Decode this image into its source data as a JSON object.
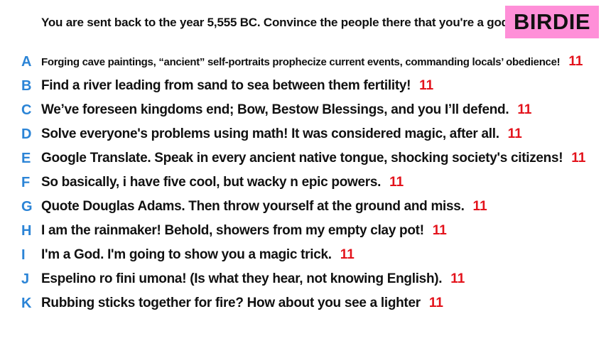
{
  "prompt": "You are sent back to the year 5,555 BC. Convince the people there that you're a god.",
  "badge": "BIRDIE",
  "colors": {
    "letter": "#2b84d6",
    "score": "#e3121b",
    "badge_bg": "#ff8fd8"
  },
  "answers": [
    {
      "letter": "A",
      "text": "Forging cave paintings, “ancient” self-portraits prophecize current events, commanding locals’ obedience!",
      "score": "11"
    },
    {
      "letter": "B",
      "text": "Find a river leading from sand to sea between them fertility!",
      "score": "11"
    },
    {
      "letter": "C",
      "text": "We’ve foreseen kingdoms end; Bow, Bestow Blessings, and you I’ll defend.",
      "score": "11"
    },
    {
      "letter": "D",
      "text": "Solve everyone's problems using math! It was considered magic, after all.",
      "score": "11"
    },
    {
      "letter": "E",
      "text": "Google Translate. Speak in every ancient native tongue, shocking society's citizens!",
      "score": "11"
    },
    {
      "letter": "F",
      "text": "So basically, i have five cool, but wacky n epic powers.",
      "score": "11"
    },
    {
      "letter": "G",
      "text": "Quote Douglas Adams. Then throw yourself at the ground and miss.",
      "score": "11"
    },
    {
      "letter": "H",
      "text": "I am the rainmaker! Behold, showers from my empty clay pot!",
      "score": "11"
    },
    {
      "letter": "I",
      "text": "I'm a God. I'm going to show you a magic trick.",
      "score": "11"
    },
    {
      "letter": "J",
      "text": "Espelino ro fini umona! (Is what they hear, not knowing English).",
      "score": "11"
    },
    {
      "letter": "K",
      "text": "Rubbing sticks together for fire? How about you see a lighter",
      "score": "11"
    }
  ]
}
